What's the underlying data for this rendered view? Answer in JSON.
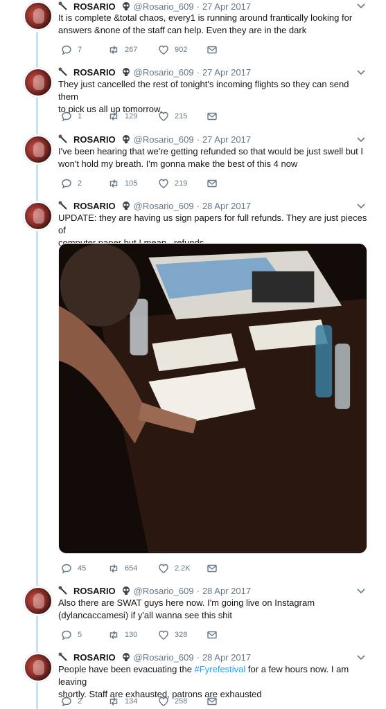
{
  "tweets": [
    {
      "name": "ROSARIO",
      "handle": "@Rosario_609",
      "date": "27 Apr 2017",
      "text_lines": [
        "It is complete &total chaos, every1 is running around frantically looking for",
        "answers &none of the staff can help. Even they are in the dark"
      ],
      "replies": "7",
      "retweets": "267",
      "likes": "902"
    },
    {
      "name": "ROSARIO",
      "handle": "@Rosario_609",
      "date": "27 Apr 2017",
      "text_lines": [
        "They just cancelled the rest of tonight's incoming flights so they can send them",
        "to pick us all up tomorrow."
      ],
      "replies": "1",
      "retweets": "129",
      "likes": "215"
    },
    {
      "name": "ROSARIO",
      "handle": "@Rosario_609",
      "date": "27 Apr 2017",
      "text_lines": [
        "I've been hearing that we're getting refunded so that would be just swell but I",
        "won't hold my breath. I'm gonna make the best of this 4 now"
      ],
      "replies": "2",
      "retweets": "105",
      "likes": "219"
    },
    {
      "name": "ROSARIO",
      "handle": "@Rosario_609",
      "date": "28 Apr 2017",
      "text_lines": [
        "UPDATE: they are having us sign papers for full refunds. They are just pieces of",
        "computer paper but I mean...refunds"
      ],
      "replies": "45",
      "retweets": "654",
      "likes": "2.2K"
    },
    {
      "name": "ROSARIO",
      "handle": "@Rosario_609",
      "date": "28 Apr 2017",
      "text_lines": [
        "Also there are SWAT guys here now. I'm going live on Instagram",
        "(dylancaccamesi) if y'all wanna see this shit"
      ],
      "replies": "5",
      "retweets": "130",
      "likes": "328"
    },
    {
      "name": "ROSARIO",
      "handle": "@Rosario_609",
      "date": "28 Apr 2017",
      "text_line1_before": "People have been evacuating the ",
      "text_hashtag": "#Fyrefestival",
      "text_line1_after": " for a few hours now. I am leaving",
      "text_line2": "shortly. Staff are exhausted, patrons are exhausted",
      "replies": "2",
      "retweets": "134",
      "likes": "258"
    }
  ],
  "colors": {
    "thread_line": "#c4e4f6",
    "link": "#1da1f2",
    "muted": "#657786",
    "text": "#14171a"
  },
  "icons": [
    "microphone-icon",
    "skull-icon",
    "chevron-down-icon",
    "reply-icon",
    "retweet-icon",
    "heart-icon",
    "direct-message-icon"
  ]
}
